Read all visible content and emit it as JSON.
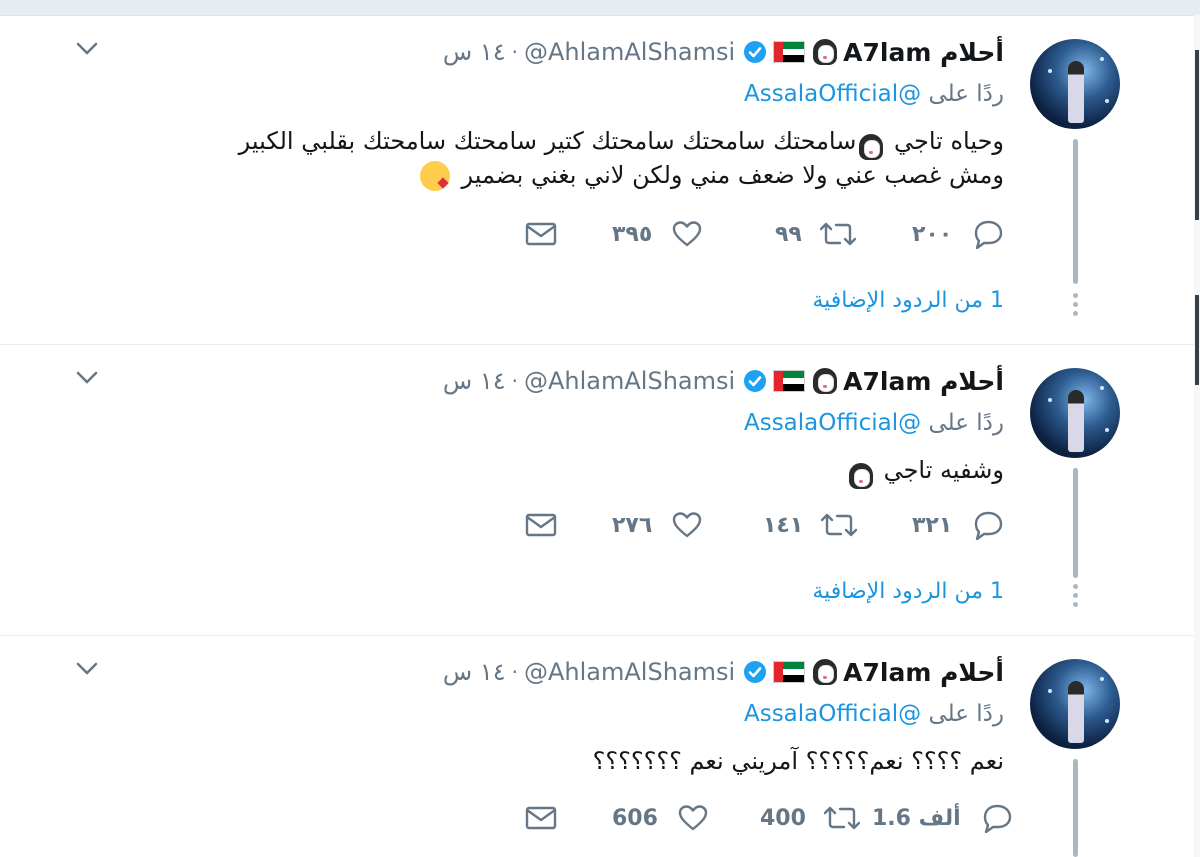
{
  "tweets": [
    {
      "name": "A7lam أحلام",
      "handle": "@AhlamAlShamsi",
      "time": "١٤ س",
      "replying_prefix": "ردًا على",
      "replying_to": "@AssalaOfficial",
      "text_line1_start": "وحياه تاجي",
      "text_line1_end": "سامحتك سامحتك سامحتك كتير  سامحتك سامحتك بقلبي الكبير",
      "text_line2": "ومش غصب عني ولا ضعف مني ولكن لاني بغني بضمير",
      "replies": "٢٠٠",
      "retweets": "٩٩",
      "likes": "٣٩٥",
      "more_replies": "1 من الردود الإضافية"
    },
    {
      "name": "A7lam أحلام",
      "handle": "@AhlamAlShamsi",
      "time": "١٤ س",
      "replying_prefix": "ردًا على",
      "replying_to": "@AssalaOfficial",
      "text": "وشفيه تاجي",
      "replies": "٣٢١",
      "retweets": "١٤١",
      "likes": "٢٧٦",
      "more_replies": "1 من الردود الإضافية"
    },
    {
      "name": "A7lam أحلام",
      "handle": "@AhlamAlShamsi",
      "time": "١٤ س",
      "replying_prefix": "ردًا على",
      "replying_to": "@AssalaOfficial",
      "text": "نعم ؟؟؟؟ نعم؟؟؟؟؟ آمريني نعم ؟؟؟؟؟؟؟",
      "replies": "1.6 ألف",
      "retweets": "400",
      "likes": "606"
    }
  ],
  "separator": "·",
  "icons": {
    "verified": "verified-badge-icon",
    "flag": "uae-flag-icon",
    "emoji": "girl-emoji-icon",
    "kiss": "kiss-emoji-icon",
    "reply": "reply-icon",
    "retweet": "retweet-icon",
    "like": "heart-icon",
    "dm": "envelope-icon",
    "menu": "chevron-down-icon"
  },
  "colors": {
    "link": "#1b95e0",
    "muted": "#657786",
    "text": "#14171a",
    "thread_line": "#aab8c2"
  }
}
